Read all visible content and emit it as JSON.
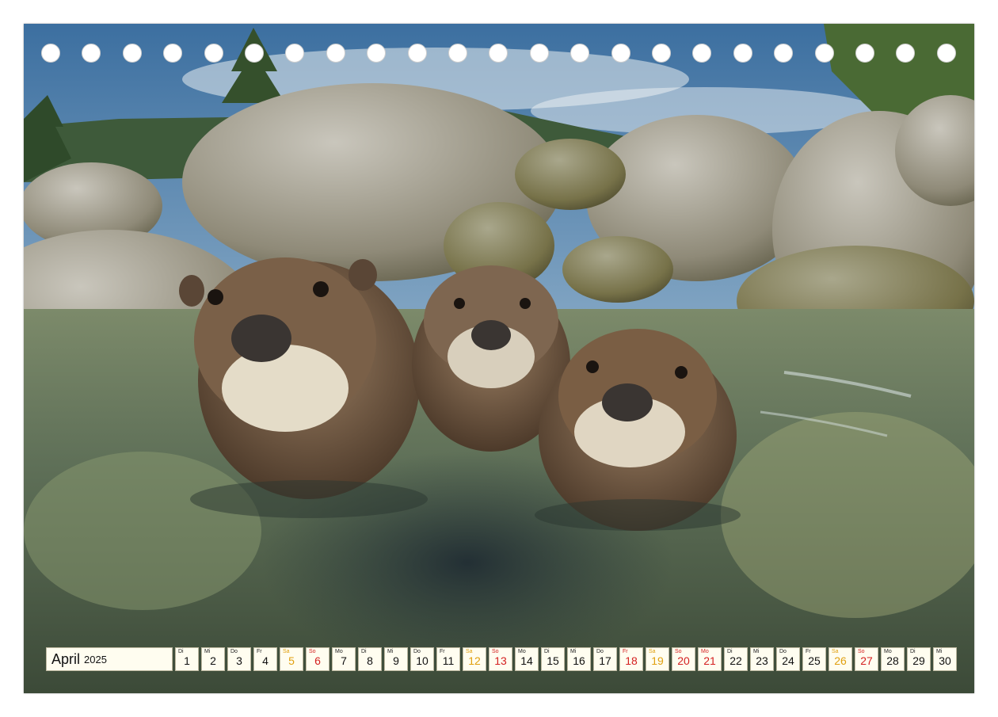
{
  "calendar": {
    "month": "April",
    "year": "2025",
    "days": [
      {
        "abbr": "Di",
        "num": "1",
        "kind": "weekday"
      },
      {
        "abbr": "Mi",
        "num": "2",
        "kind": "weekday"
      },
      {
        "abbr": "Do",
        "num": "3",
        "kind": "weekday"
      },
      {
        "abbr": "Fr",
        "num": "4",
        "kind": "weekday"
      },
      {
        "abbr": "Sa",
        "num": "5",
        "kind": "sat"
      },
      {
        "abbr": "So",
        "num": "6",
        "kind": "sun"
      },
      {
        "abbr": "Mo",
        "num": "7",
        "kind": "weekday"
      },
      {
        "abbr": "Di",
        "num": "8",
        "kind": "weekday"
      },
      {
        "abbr": "Mi",
        "num": "9",
        "kind": "weekday"
      },
      {
        "abbr": "Do",
        "num": "10",
        "kind": "weekday"
      },
      {
        "abbr": "Fr",
        "num": "11",
        "kind": "weekday"
      },
      {
        "abbr": "Sa",
        "num": "12",
        "kind": "sat"
      },
      {
        "abbr": "So",
        "num": "13",
        "kind": "sun"
      },
      {
        "abbr": "Mo",
        "num": "14",
        "kind": "weekday"
      },
      {
        "abbr": "Di",
        "num": "15",
        "kind": "weekday"
      },
      {
        "abbr": "Mi",
        "num": "16",
        "kind": "weekday"
      },
      {
        "abbr": "Do",
        "num": "17",
        "kind": "weekday"
      },
      {
        "abbr": "Fr",
        "num": "18",
        "kind": "sun"
      },
      {
        "abbr": "Sa",
        "num": "19",
        "kind": "sat"
      },
      {
        "abbr": "So",
        "num": "20",
        "kind": "sun"
      },
      {
        "abbr": "Mo",
        "num": "21",
        "kind": "sun"
      },
      {
        "abbr": "Di",
        "num": "22",
        "kind": "weekday"
      },
      {
        "abbr": "Mi",
        "num": "23",
        "kind": "weekday"
      },
      {
        "abbr": "Do",
        "num": "24",
        "kind": "weekday"
      },
      {
        "abbr": "Fr",
        "num": "25",
        "kind": "weekday"
      },
      {
        "abbr": "Sa",
        "num": "26",
        "kind": "sat"
      },
      {
        "abbr": "So",
        "num": "27",
        "kind": "sun"
      },
      {
        "abbr": "Mo",
        "num": "28",
        "kind": "weekday"
      },
      {
        "abbr": "Di",
        "num": "29",
        "kind": "weekday"
      },
      {
        "abbr": "Mi",
        "num": "30",
        "kind": "weekday"
      }
    ]
  },
  "colors": {
    "saturday": "#e0a010",
    "sunday_holiday": "#d42020",
    "cell_background": "#fffdf0"
  },
  "binding_holes": 23
}
